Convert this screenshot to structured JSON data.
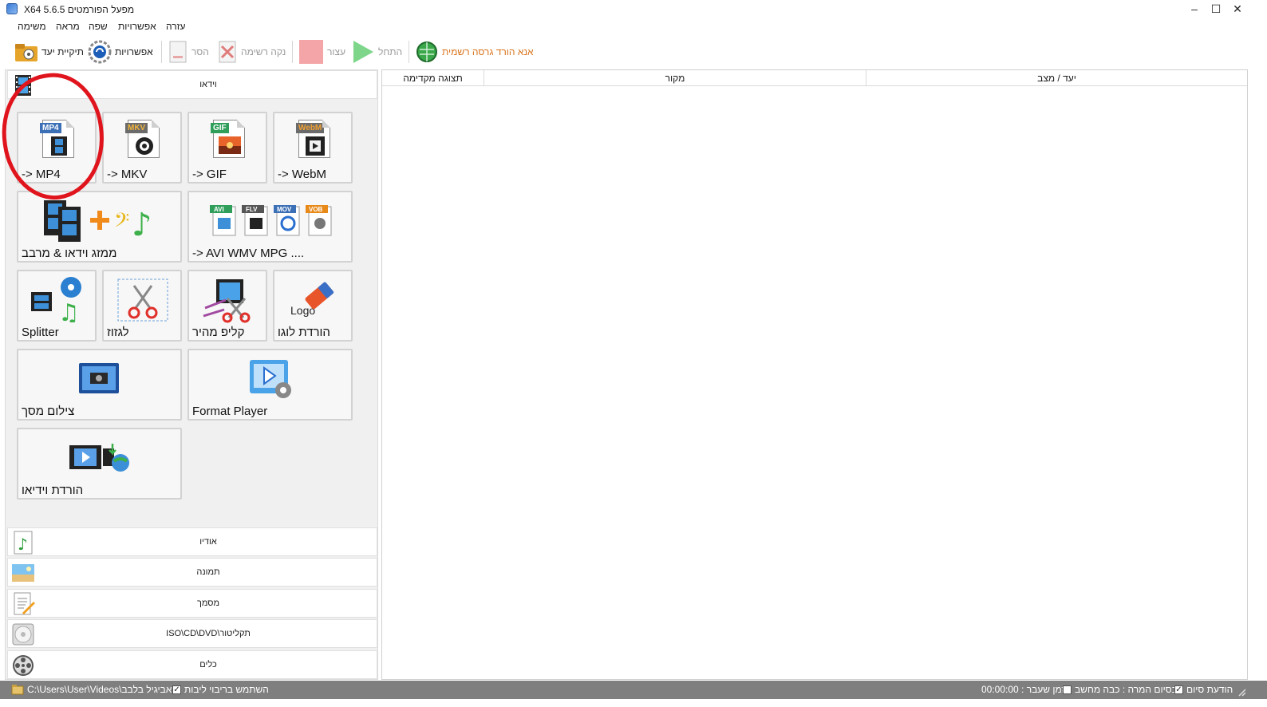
{
  "window": {
    "title": "X64 5.6.5 מפעל הפורמטים",
    "controls": {
      "minimize": "–",
      "maximize": "☐",
      "close": "✕"
    }
  },
  "menu": [
    "עזרה",
    "אפשרויות",
    "שפה",
    "מראה",
    "משימה"
  ],
  "toolbar": {
    "dest_folder": "תיקיית יעד",
    "options": "אפשרויות",
    "remove": "הסר",
    "clear_list": "נקה רשימה",
    "stop": "עצור",
    "start": "התחל",
    "download_official": "אנא הורד גרסה רשמית"
  },
  "left": {
    "video_category": "וידאו",
    "tiles": {
      "mp4": "-> MP4",
      "mkv": "-> MKV",
      "gif": "-> GIF",
      "webm": "-> WebM",
      "joiner": "ממזג וידאו & מרבב",
      "avi_etc": "-> AVI WMV MPG ....",
      "splitter": "Splitter",
      "crop": "לגזוז",
      "quick_clip": "קליפ מהיר",
      "remove_logo": "הורדת לוגו",
      "screen_record": "צילום מסך",
      "format_player": "Format Player",
      "video_download": "הורדת וידיאו"
    },
    "badges": {
      "mp4": "MP4",
      "mkv": "MKV",
      "gif": "GIF",
      "webm": "WebM",
      "avi": "AVI",
      "flv": "FLV",
      "mov": "MOV",
      "vob": "VOB",
      "logo": "Logo"
    },
    "categories": {
      "audio": "אודיו",
      "image": "תמונה",
      "document": "מסמך",
      "rom": "ISO\\CD\\DVD\\תקליטור",
      "tools": "כלים"
    }
  },
  "right": {
    "columns": {
      "preview": "תצוגה מקדימה",
      "source": "מקור",
      "dest_status": "יעד / מצב"
    }
  },
  "status": {
    "output_path": "C:\\Users\\User\\Videos\\אביגיל בלבב!",
    "multithread": "השתמש בריבוי ליבות",
    "time_elapsed": "זמן שעבר : 00:00:00",
    "shutdown": "בסיום המרה : כבה מחשב",
    "completion_notice": "הודעת סיום",
    "check": "✓"
  },
  "colors": {
    "annotation": "#e0141c",
    "statusbar": "#7f7f7f",
    "link": "#d9731c"
  }
}
